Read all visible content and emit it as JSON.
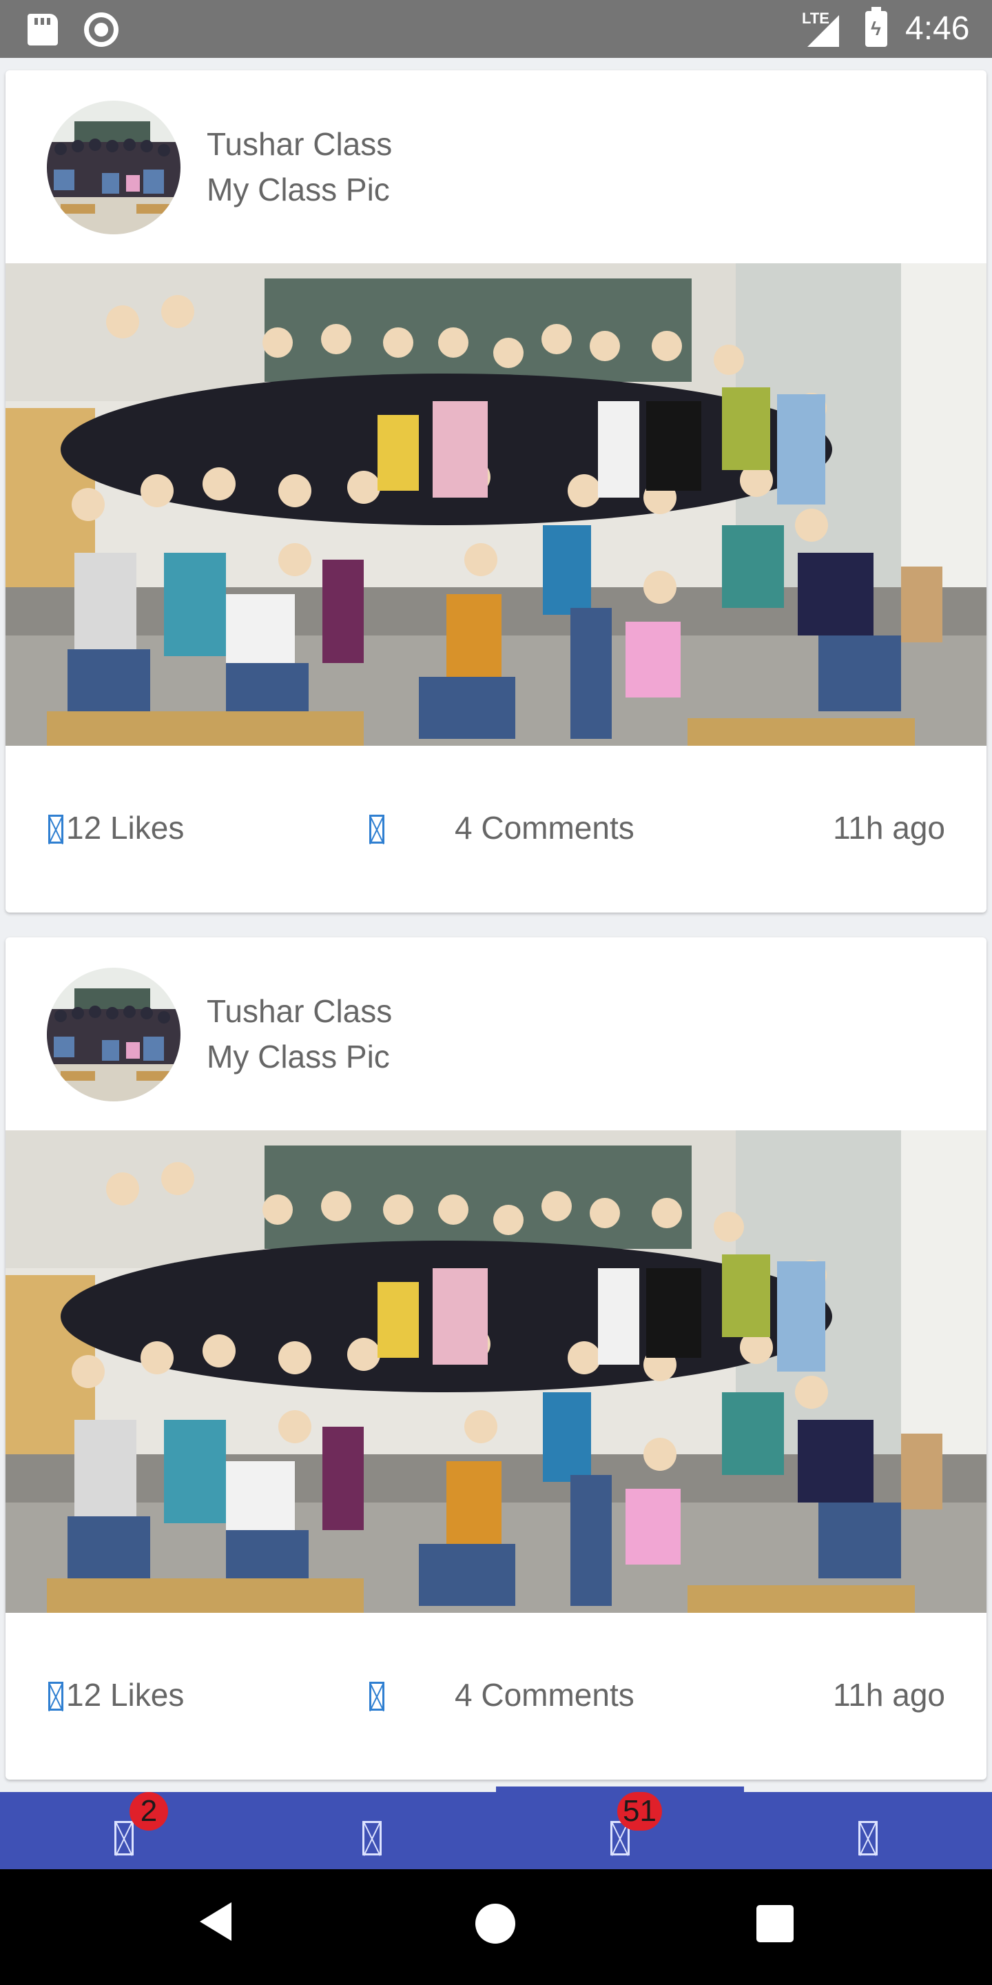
{
  "status_bar": {
    "time": "4:46",
    "network": "LTE",
    "icons": [
      "sd-card-icon",
      "record-icon",
      "signal-icon",
      "battery-charging-icon"
    ]
  },
  "feed": {
    "posts": [
      {
        "title": "Tushar Class",
        "subtitle": "My Class Pic",
        "likes": "12 Likes",
        "comments": "4 Comments",
        "time": "11h ago"
      },
      {
        "title": "Tushar Class",
        "subtitle": "My Class Pic",
        "likes": "12 Likes",
        "comments": "4 Comments",
        "time": "11h ago"
      }
    ]
  },
  "bottom_nav": {
    "items": [
      {
        "icon": "tab-1-icon",
        "badge": "2"
      },
      {
        "icon": "tab-2-icon",
        "badge": ""
      },
      {
        "icon": "tab-3-icon",
        "badge": "51",
        "selected": true
      },
      {
        "icon": "tab-4-icon",
        "badge": ""
      }
    ]
  },
  "colors": {
    "accent": "#3f51b5",
    "badge": "#e0202a",
    "icon_blue": "#2f7fd1",
    "text_secondary": "#666666",
    "status_bar": "#757575"
  }
}
